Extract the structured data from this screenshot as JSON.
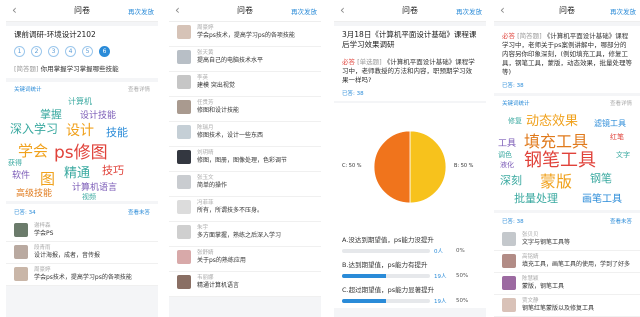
{
  "common": {
    "nav_title": "问卷",
    "resend": "再次发放",
    "view_detail": "查看详情",
    "view_unanswered": "查看未答"
  },
  "panel1": {
    "title": "课前调研-环境设计2102",
    "steps": [
      "1",
      "2",
      "3",
      "4",
      "5",
      "6"
    ],
    "active_step": "6",
    "question_tag": "[简答题]",
    "question": "你用掌握学习掌握哪些技能",
    "keyword_stats": "关键词统计",
    "answered": "已答: 34",
    "cloud": [
      {
        "text": "计算机",
        "color": "#3aa9a0"
      },
      {
        "text": "掌握",
        "color": "#3aa9a0"
      },
      {
        "text": "设计技能",
        "color": "#7b5bb7"
      },
      {
        "text": "深入学习",
        "color": "#3aa9a0"
      },
      {
        "text": "设计",
        "color": "#f0a11c"
      },
      {
        "text": "技能",
        "color": "#2a8bd8"
      },
      {
        "text": "学会",
        "color": "#f0a11c"
      },
      {
        "text": "ps修图",
        "color": "#e0423a"
      },
      {
        "text": "获得",
        "color": "#3aa9a0"
      },
      {
        "text": "软件",
        "color": "#7b5bb7"
      },
      {
        "text": "精通",
        "color": "#3aa9a0"
      },
      {
        "text": "技巧",
        "color": "#e0423a"
      },
      {
        "text": "图",
        "color": "#f0a11c"
      },
      {
        "text": "计算机语言",
        "color": "#7b5bb7"
      },
      {
        "text": "高级技能",
        "color": "#e07a1c"
      },
      {
        "text": "视频",
        "color": "#3aa9a0"
      }
    ],
    "people": [
      {
        "name": "谢梓森",
        "text": "学会PS",
        "avatar": "#6b7b6b"
      },
      {
        "name": "段青雨",
        "text": "设计海报，成者，音传报",
        "avatar": "#b9a9a0"
      },
      {
        "name": "周豪婷",
        "text": "学会ps技术，提高学习ps的各项技能",
        "avatar": "#c9b6a8"
      }
    ]
  },
  "panel2": {
    "people": [
      {
        "name": "周豪婷",
        "text": "学会ps技术，提高学习ps的各项技能",
        "avatar": "#d6c3b7"
      },
      {
        "name": "张天黄",
        "text": "提高自己的电脑技术水平",
        "avatar": "#b8bfc6"
      },
      {
        "name": "李英",
        "text": "建模 突出视觉",
        "avatar": "#c6c6c6"
      },
      {
        "name": "任贯芳",
        "text": "修图和设计技能",
        "avatar": "#a99a8f"
      },
      {
        "name": "陈瑞月",
        "text": "修图技术，设计一些东西",
        "avatar": "#c5cfd6"
      },
      {
        "name": "刘玥晴",
        "text": "修图，图册，图像处理，色彩调节",
        "avatar": "#333740"
      },
      {
        "name": "张玉文",
        "text": "简单的操作",
        "avatar": "#c9ccd0"
      },
      {
        "name": "冯菲菲",
        "text": "所有，所谓技多不压身。",
        "avatar": "#dcdcdc"
      },
      {
        "name": "朱宇",
        "text": "多方面掌握，熟练之后深入学习",
        "avatar": "#cfcfcf"
      },
      {
        "name": "张舒婧",
        "text": "关于ps的熟练应用",
        "avatar": "#d8a9a9"
      },
      {
        "name": "韦丽娜",
        "text": "精通计算机语言",
        "avatar": "#8a6f64"
      }
    ]
  },
  "panel3": {
    "title": "3月18日《计算机平面设计基础》课程课后学习效果调研",
    "question_tag": "必答",
    "question_type": "[单选题]",
    "question": "《计算机平面设计基础》课程学习中，老师教授的方法和内容，职预期学习效果一样吗?",
    "answered_label": "已答: 38",
    "pie_label_c": "C: 50 %",
    "pie_label_b": "B: 50 %",
    "chart_data": {
      "type": "pie",
      "categories": [
        "A",
        "B",
        "C"
      ],
      "values": [
        0,
        50,
        50
      ],
      "colors": [
        "#2a8bd8",
        "#f7c21c",
        "#f0741c"
      ]
    },
    "options": [
      {
        "text": "A.没达到期望值，ps能力没提升",
        "count": "0人",
        "pct": "0%",
        "fill": 0
      },
      {
        "text": "B.达到期望值，ps能力有提升",
        "count": "19人",
        "pct": "50%",
        "fill": 50
      },
      {
        "text": "C.超过期望值，ps能力显著提升",
        "count": "19人",
        "pct": "50%",
        "fill": 50
      }
    ]
  },
  "panel4": {
    "question_tag": "必答",
    "question_type": "[简答题]",
    "question": "《计算机平面设计基础》课程学习中，老师关于ps案例讲解中，哪部分的内容另你印象深刻，(例如填充工具，修复工具，钢笔工具，蒙版，动态效果，批量处理等等)",
    "answered_label": "已答: 38",
    "keyword_stats": "关键词统计",
    "answered": "已答: 38",
    "cloud": [
      {
        "text": "动态效果",
        "color": "#f0a11c"
      },
      {
        "text": "修复",
        "color": "#3aa9a0"
      },
      {
        "text": "滤镜工具",
        "color": "#2a8bd8"
      },
      {
        "text": "填充工具",
        "color": "#e07a1c"
      },
      {
        "text": "工具",
        "color": "#7b5bb7"
      },
      {
        "text": "红笔",
        "color": "#e0423a"
      },
      {
        "text": "钢笔工具",
        "color": "#e0423a"
      },
      {
        "text": "调色",
        "color": "#3aa9a0"
      },
      {
        "text": "液化",
        "color": "#7b5bb7"
      },
      {
        "text": "深刻",
        "color": "#3aa9a0"
      },
      {
        "text": "蒙版",
        "color": "#f0a11c"
      },
      {
        "text": "钢笔",
        "color": "#3aa9a0"
      },
      {
        "text": "批量处理",
        "color": "#3aa9a0"
      },
      {
        "text": "画笔工具",
        "color": "#2a8bd8"
      },
      {
        "text": "文字",
        "color": "#3aa9a0"
      }
    ],
    "people": [
      {
        "name": "张贝贝",
        "text": "文字与钢笔工具等",
        "avatar": "#c4c8cc"
      },
      {
        "name": "高铭婧",
        "text": "填充工具，画笔工具的使用，学到了好多",
        "avatar": "#b28c86"
      },
      {
        "name": "陈慧颖",
        "text": "蒙版，钢笔工具",
        "avatar": "#9c6aa1"
      },
      {
        "name": "贾文静",
        "text": "钢笔红笔蒙版以及修复工具",
        "avatar": "#d9c2b8"
      }
    ]
  }
}
